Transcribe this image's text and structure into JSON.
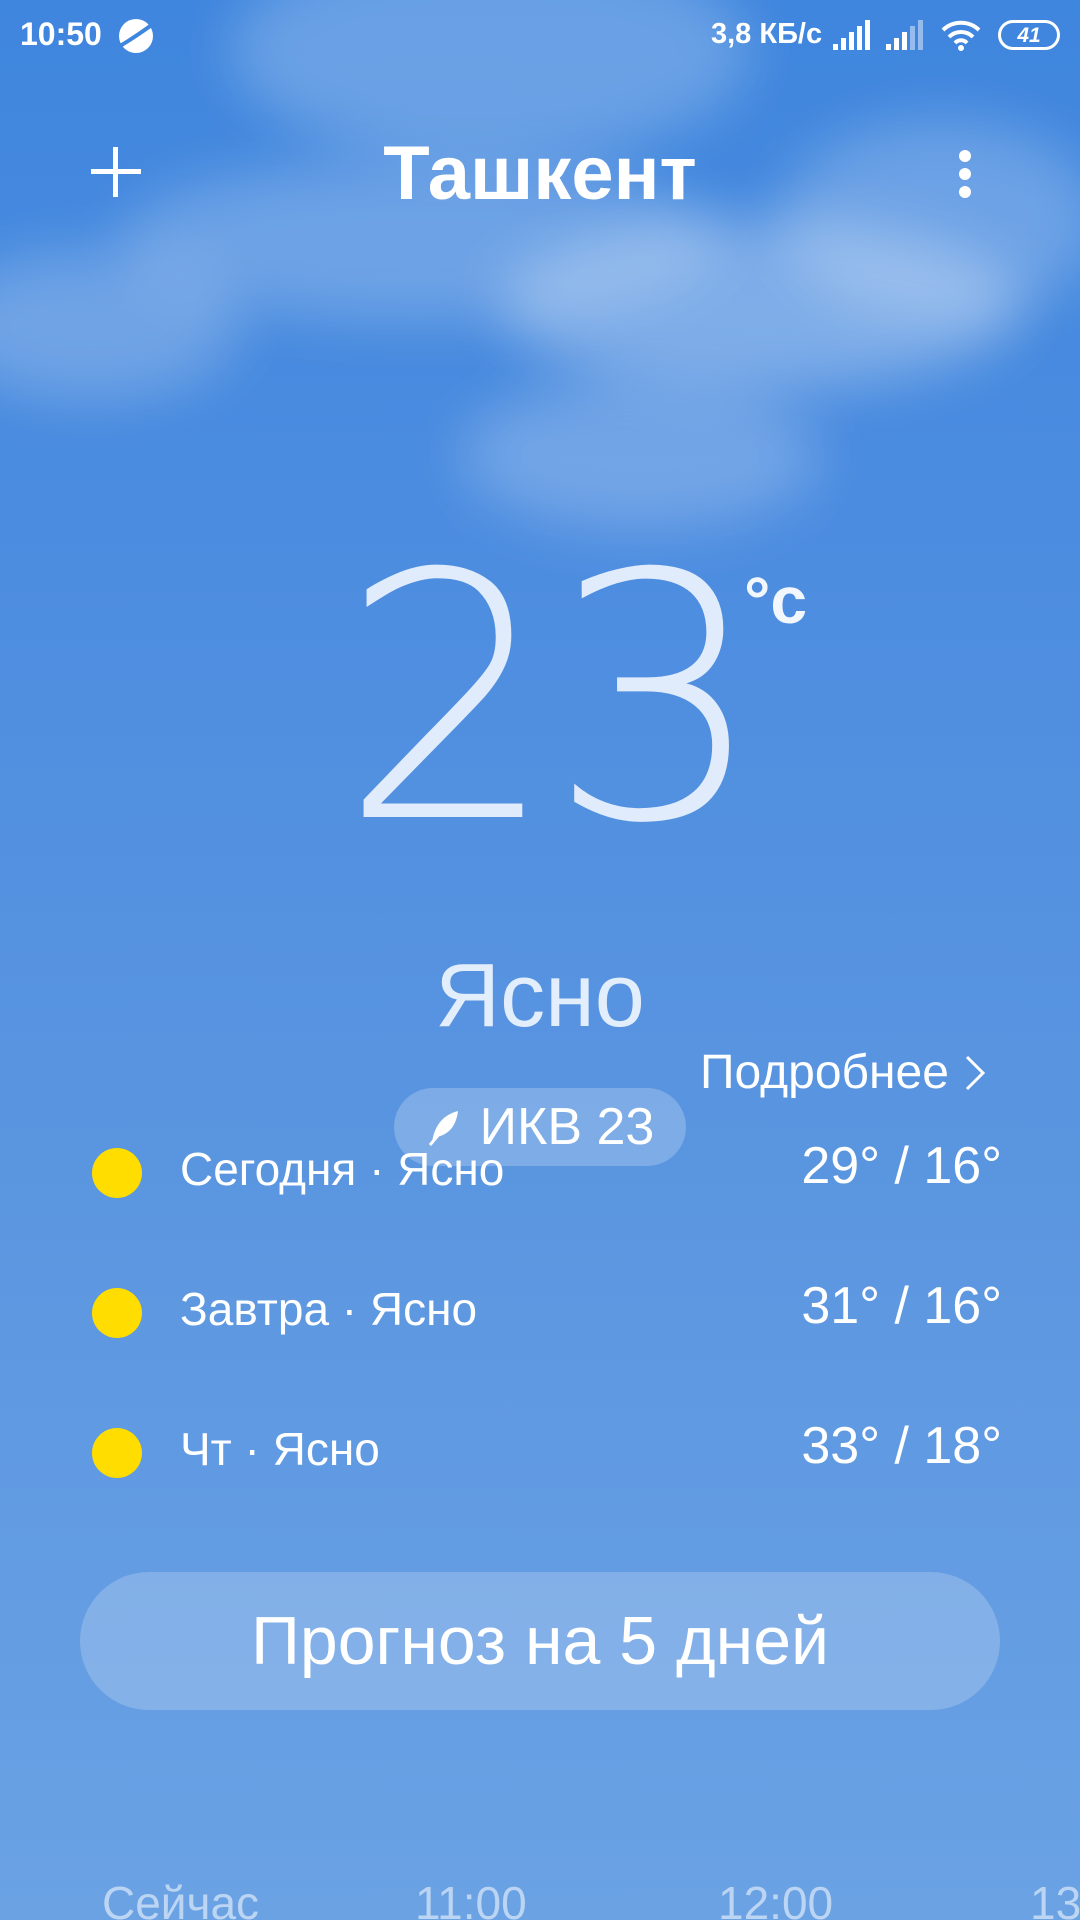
{
  "status_bar": {
    "time": "10:50",
    "network_speed": "3,8 КБ/с",
    "battery": "41",
    "icons": [
      "planet-icon",
      "signal-icon",
      "signal-icon",
      "wifi-icon",
      "battery-icon"
    ]
  },
  "header": {
    "city": "Ташкент",
    "add_icon": "plus-icon",
    "more_icon": "more-vertical-icon"
  },
  "current": {
    "temperature": "23",
    "unit": "°c",
    "condition": "Ясно",
    "details_label": "Подробнее",
    "aqi_label": "ИКВ 23"
  },
  "forecast": [
    {
      "label": "Сегодня · Ясно",
      "temps": "29° / 16°",
      "icon": "sun-icon"
    },
    {
      "label": "Завтра · Ясно",
      "temps": "31° / 16°",
      "icon": "sun-icon"
    },
    {
      "label": "Чт · Ясно",
      "temps": "33° / 18°",
      "icon": "sun-icon"
    }
  ],
  "forecast_button": "Прогноз на 5 дней",
  "hourly": [
    "Сейчас",
    "11:00",
    "12:00",
    "13"
  ],
  "colors": {
    "sky_top": "#3f86de",
    "sky_bottom": "#6aa2e4",
    "sun": "#ffdd00"
  }
}
